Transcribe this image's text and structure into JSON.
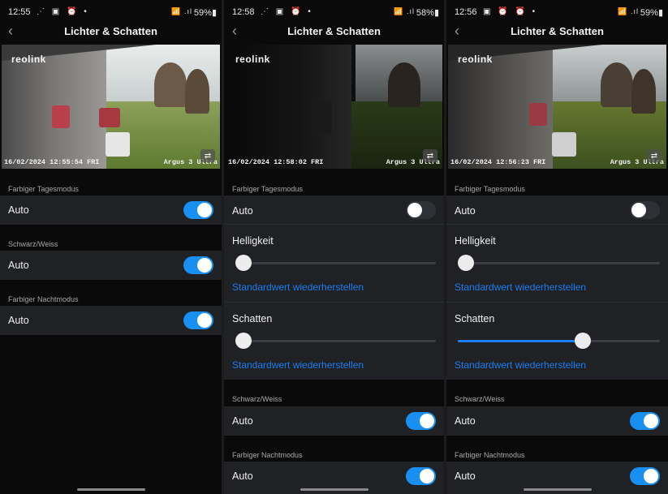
{
  "screens": [
    {
      "status": {
        "time": "12:55",
        "icons": "⋰ ▣ ⏰ •",
        "signal": "📶 .ıl",
        "battery": "59%▮"
      },
      "title": "Lichter & Schatten",
      "camera": {
        "logo": "reolink",
        "timestamp": "16/02/2024 12:55:54 FRI",
        "model": "Argus 3 Ultra"
      },
      "sections": {
        "day_mode": {
          "header": "Farbiger Tagesmodus",
          "auto_label": "Auto",
          "auto_on": true
        },
        "bw": {
          "header": "Schwarz/Weiss",
          "auto_label": "Auto",
          "auto_on": true
        },
        "night_mode": {
          "header": "Farbiger Nachtmodus",
          "auto_label": "Auto",
          "auto_on": true
        }
      }
    },
    {
      "status": {
        "time": "12:58",
        "icons": "⋰ ▣ ⏰ •",
        "signal": "📶 .ıl",
        "battery": "58%▮"
      },
      "title": "Lichter & Schatten",
      "camera": {
        "logo": "reolink",
        "timestamp": "16/02/2024 12:58:02 FRI",
        "model": "Argus 3 Ultra"
      },
      "sections": {
        "day_mode": {
          "header": "Farbiger Tagesmodus",
          "auto_label": "Auto",
          "auto_on": false,
          "brightness_label": "Helligkeit",
          "brightness_value": 0.0,
          "brightness_reset": "Standardwert wiederherstellen",
          "shadow_label": "Schatten",
          "shadow_value": 0.0,
          "shadow_reset": "Standardwert wiederherstellen"
        },
        "bw": {
          "header": "Schwarz/Weiss",
          "auto_label": "Auto",
          "auto_on": true
        },
        "night_mode": {
          "header": "Farbiger Nachtmodus",
          "auto_label": "Auto",
          "auto_on": true
        }
      }
    },
    {
      "status": {
        "time": "12:56",
        "icons": "▣ ⏰ ⏰ •",
        "signal": "📶 .ıl",
        "battery": "59%▮"
      },
      "title": "Lichter & Schatten",
      "camera": {
        "logo": "reolink",
        "timestamp": "16/02/2024 12:56:23 FRI",
        "model": "Argus 3 Ultra"
      },
      "sections": {
        "day_mode": {
          "header": "Farbiger Tagesmodus",
          "auto_label": "Auto",
          "auto_on": false,
          "brightness_label": "Helligkeit",
          "brightness_value": 0.0,
          "brightness_reset": "Standardwert wiederherstellen",
          "shadow_label": "Schatten",
          "shadow_value": 0.63,
          "shadow_reset": "Standardwert wiederherstellen"
        },
        "bw": {
          "header": "Schwarz/Weiss",
          "auto_label": "Auto",
          "auto_on": true
        },
        "night_mode": {
          "header": "Farbiger Nachtmodus",
          "auto_label": "Auto",
          "auto_on": true
        }
      }
    }
  ],
  "colors": {
    "accent": "#1a8ff2",
    "row_bg": "#1f2124",
    "page_bg": "#0a0a0a",
    "toggle_off": "#2d3035"
  },
  "icons": {
    "back": "chevron-left-icon",
    "snapshot": "camera-switch-icon"
  }
}
